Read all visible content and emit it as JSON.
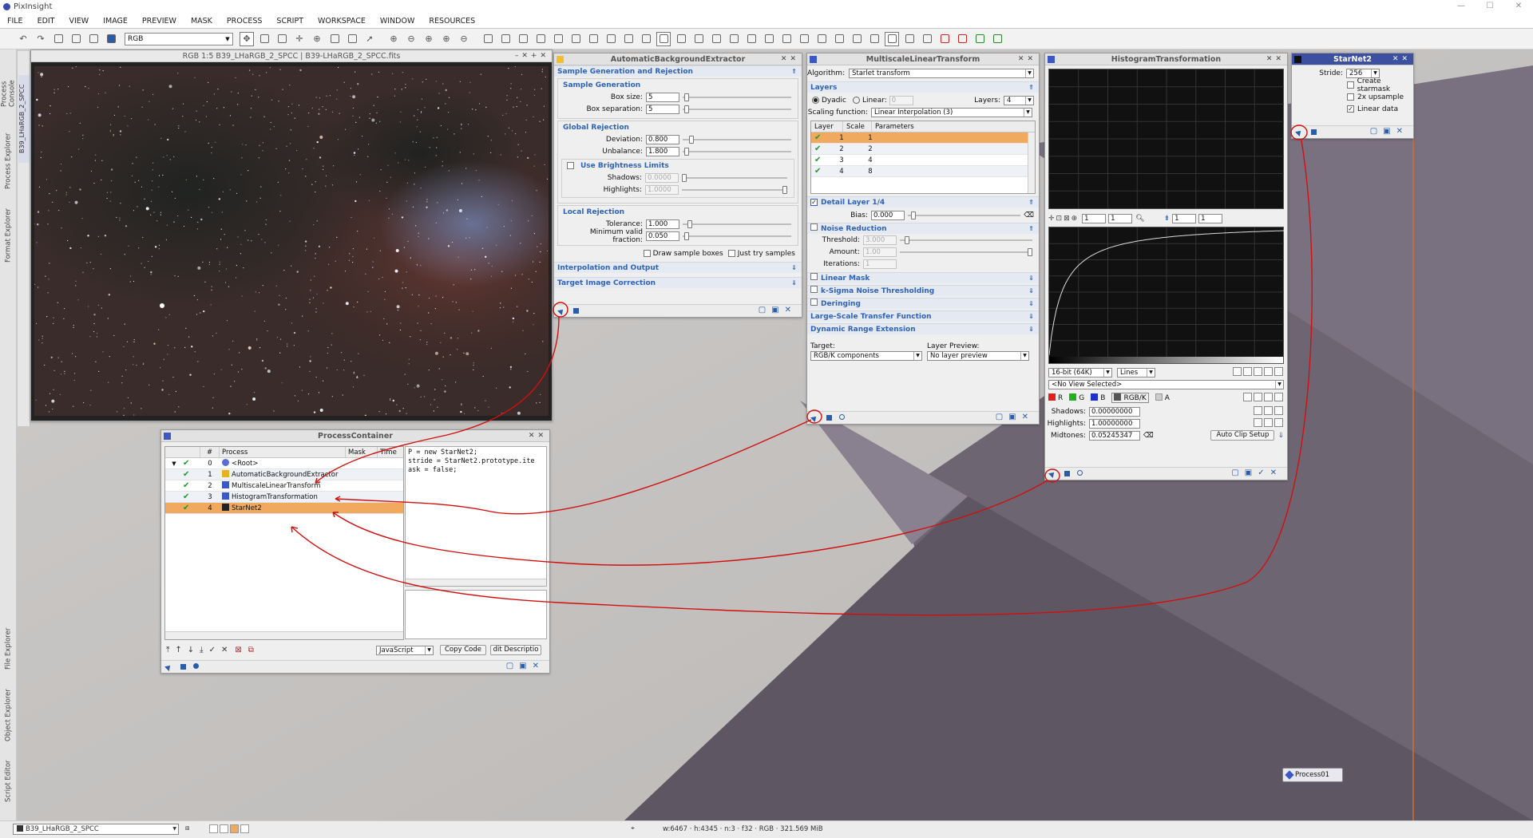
{
  "app": {
    "title": "PixInsight"
  },
  "menu": [
    "FILE",
    "EDIT",
    "VIEW",
    "IMAGE",
    "PREVIEW",
    "MASK",
    "PROCESS",
    "SCRIPT",
    "WORKSPACE",
    "WINDOW",
    "RESOURCES"
  ],
  "toolbar": {
    "view_selector": "RGB"
  },
  "side_tabs": {
    "top": [
      "Process Console",
      "Process Explorer",
      "Format Explorer"
    ],
    "bottom": [
      "File Explorer",
      "Object Explorer",
      "Script Editor"
    ],
    "image_tab": "B39_LHaRGB_2_SPCC"
  },
  "image_window": {
    "title": "RGB 1:5 B39_LHaRGB_2_SPCC | B39-LHaRGB_2_SPCC.fits"
  },
  "abe": {
    "title": "AutomaticBackgroundExtractor",
    "sec_sample": "Sample Generation and Rejection",
    "grp_generation": "Sample Generation",
    "box_size_label": "Box size:",
    "box_size": "5",
    "box_sep_label": "Box separation:",
    "box_sep": "5",
    "grp_global": "Global Rejection",
    "deviation_label": "Deviation:",
    "deviation": "0.800",
    "unbalance_label": "Unbalance:",
    "unbalance": "1.800",
    "brightness_label": "Use Brightness Limits",
    "shadows_label": "Shadows:",
    "shadows": "0.0000",
    "highlights_label": "Highlights:",
    "highlights": "1.0000",
    "grp_local": "Local Rejection",
    "tolerance_label": "Tolerance:",
    "tolerance": "1.000",
    "minvalid_label": "Minimum valid fraction:",
    "minvalid": "0.050",
    "draw_samples": "Draw sample boxes",
    "just_try": "Just try samples",
    "sec_interp": "Interpolation and Output",
    "sec_target": "Target Image Correction"
  },
  "mlt": {
    "title": "MultiscaleLinearTransform",
    "algorithm_label": "Algorithm:",
    "algorithm": "Starlet transform",
    "sec_layers": "Layers",
    "dyadic": "Dyadic",
    "linear": "Linear:",
    "linear_val": "0",
    "layers_label": "Layers:",
    "layers_val": "4",
    "scaling_label": "Scaling function:",
    "scaling": "Linear Interpolation (3)",
    "headers": [
      "Layer",
      "Scale",
      "Parameters"
    ],
    "rows": [
      {
        "layer": "1",
        "scale": "1"
      },
      {
        "layer": "2",
        "scale": "2"
      },
      {
        "layer": "3",
        "scale": "4"
      },
      {
        "layer": "4",
        "scale": "8"
      }
    ],
    "sec_detail": "Detail Layer 1/4",
    "bias_label": "Bias:",
    "bias": "0.000",
    "sec_noise": "Noise Reduction",
    "threshold_label": "Threshold:",
    "threshold": "3.000",
    "amount_label": "Amount:",
    "amount": "1.00",
    "iterations_label": "Iterations:",
    "iterations": "1",
    "sec_linmask": "Linear Mask",
    "sec_ksigma": "k-Sigma Noise Thresholding",
    "sec_deringing": "Deringing",
    "sec_largescale": "Large-Scale Transfer Function",
    "sec_dre": "Dynamic Range Extension",
    "target_label": "Target:",
    "target": "RGB/K components",
    "preview_label": "Layer Preview:",
    "preview": "No layer preview"
  },
  "ht": {
    "title": "HistogramTransformation",
    "zoom_vals": [
      "1",
      "1",
      "1",
      "1"
    ],
    "bits": "16-bit (64K)",
    "mode": "Lines",
    "view": "<No View Selected>",
    "channels": [
      {
        "name": "R",
        "color": "#e02020"
      },
      {
        "name": "G",
        "color": "#20b020"
      },
      {
        "name": "B",
        "color": "#2030d0"
      },
      {
        "name": "RGB/K",
        "color": "#555555"
      },
      {
        "name": "A",
        "color": "#cccccc"
      }
    ],
    "shadows_label": "Shadows:",
    "shadows": "0.00000000",
    "highlights_label": "Highlights:",
    "highlights": "1.00000000",
    "midtones_label": "Midtones:",
    "midtones": "0.05245347",
    "autoclip": "Auto Clip Setup"
  },
  "starnet": {
    "title": "StarNet2",
    "stride_label": "Stride:",
    "stride": "256",
    "create_starmask": "Create starmask",
    "upsample": "2x upsample",
    "linear_data": "Linear data"
  },
  "pc": {
    "title": "ProcessContainer",
    "headers": [
      "#",
      "Process",
      "Mask",
      "Time"
    ],
    "rows": [
      {
        "n": "0",
        "name": "<Root>"
      },
      {
        "n": "1",
        "name": "AutomaticBackgroundExtractor"
      },
      {
        "n": "2",
        "name": "MultiscaleLinearTransform"
      },
      {
        "n": "3",
        "name": "HistogramTransformation"
      },
      {
        "n": "4",
        "name": "StarNet2"
      }
    ],
    "code": [
      "P = new StarNet2;",
      "stride = StarNet2.prototype.ite",
      "ask = false;"
    ],
    "lang": "JavaScript",
    "copy_code": "Copy Code",
    "edit_desc": "dit Descriptio"
  },
  "process_icon": {
    "label": "Process01"
  },
  "status": {
    "view": "B39_LHaRGB_2_SPCC",
    "info": "w:6467 · h:4345 · n:3 · f32 · RGB · 321.569 MiB"
  },
  "colors": {
    "accent": "#2f63b8",
    "selection": "#f0a95f",
    "annotation": "#d01010",
    "titlebar_active": "#3d4fa0"
  }
}
